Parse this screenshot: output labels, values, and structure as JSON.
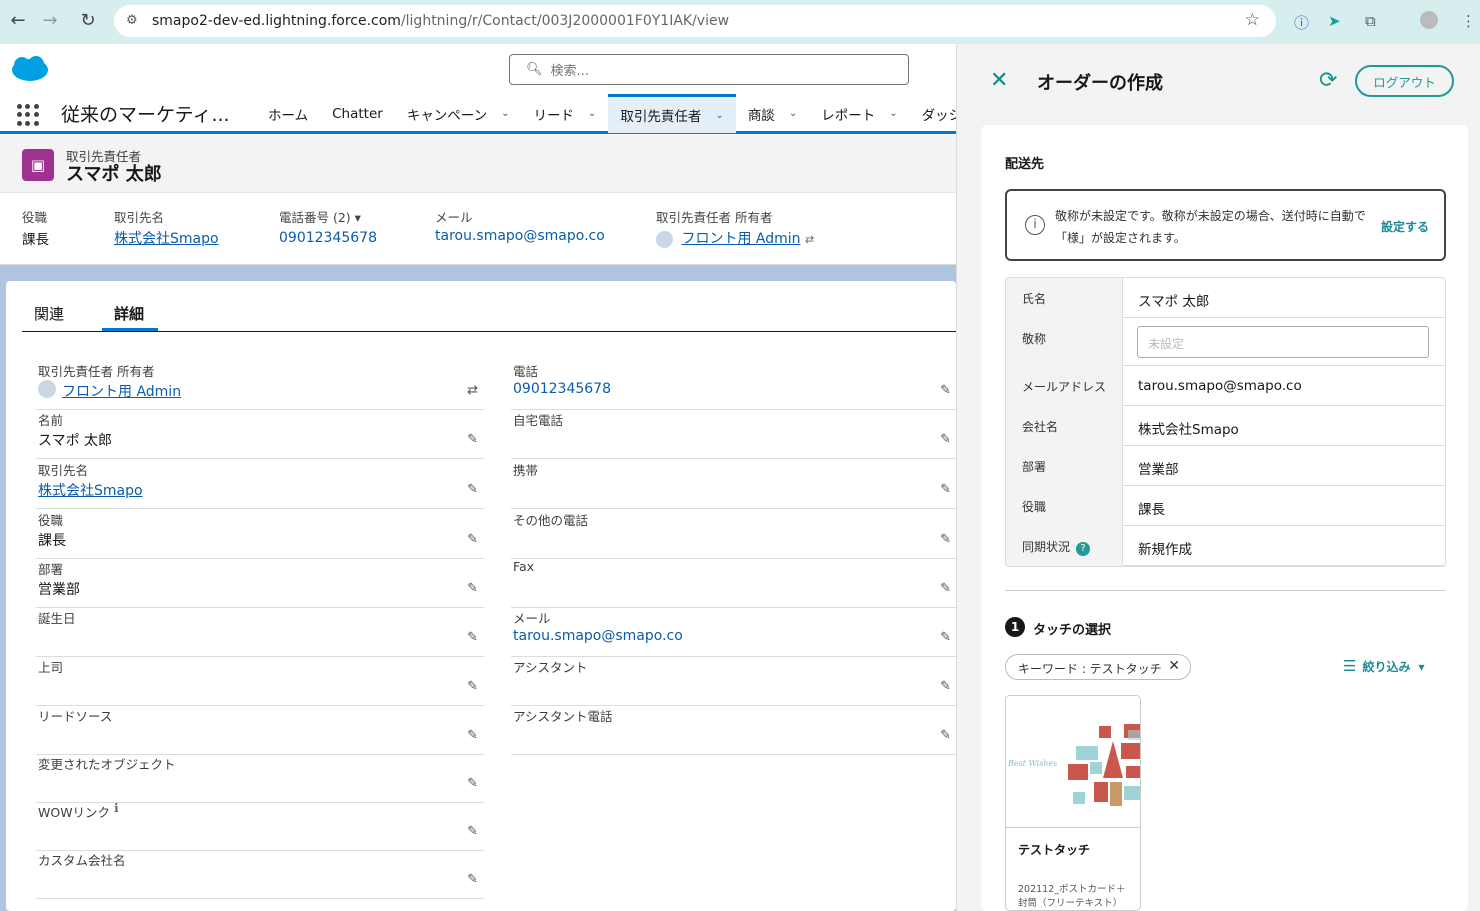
{
  "browser": {
    "url_host": "smapo2-dev-ed.lightning.force.com",
    "url_path": "/lightning/r/Contact/003J2000001F0Y1IAK/view"
  },
  "header": {
    "search_placeholder": "検索...",
    "app_name": "従来のマーケティ...",
    "tabs": [
      {
        "label": "ホーム",
        "chevron": false
      },
      {
        "label": "Chatter",
        "chevron": false
      },
      {
        "label": "キャンペーン",
        "chevron": true
      },
      {
        "label": "リード",
        "chevron": true
      },
      {
        "label": "取引先責任者",
        "chevron": true,
        "active": true
      },
      {
        "label": "商談",
        "chevron": true
      },
      {
        "label": "レポート",
        "chevron": true
      },
      {
        "label": "ダッシ",
        "chevron": false
      }
    ]
  },
  "record": {
    "object_label": "取引先責任者",
    "name": "スマポ 太郎",
    "highlights": {
      "title_label": "役職",
      "title_value": "課長",
      "account_label": "取引先名",
      "account_value": "株式会社Smapo",
      "phone_label": "電話番号 (2)",
      "phone_value": "09012345678",
      "email_label": "メール",
      "email_value": "tarou.smapo@smapo.co",
      "owner_label": "取引先責任者 所有者",
      "owner_value": "フロント用 Admin"
    }
  },
  "detail": {
    "tabs": [
      "関連",
      "詳細"
    ],
    "left": [
      {
        "label": "取引先責任者 所有者",
        "value": "フロント用 Admin",
        "link": true
      },
      {
        "label": "名前",
        "value": "スマポ 太郎"
      },
      {
        "label": "取引先名",
        "value": "株式会社Smapo",
        "link": true
      },
      {
        "label": "役職",
        "value": "課長"
      },
      {
        "label": "部署",
        "value": "営業部"
      },
      {
        "label": "誕生日",
        "value": ""
      },
      {
        "label": "上司",
        "value": ""
      },
      {
        "label": "リードソース",
        "value": ""
      },
      {
        "label": "変更されたオブジェクト",
        "value": ""
      },
      {
        "label": "WOWリンク",
        "value": ""
      },
      {
        "label": "カスタム会社名",
        "value": ""
      }
    ],
    "right": [
      {
        "label": "電話",
        "value": "09012345678"
      },
      {
        "label": "自宅電話",
        "value": ""
      },
      {
        "label": "携帯",
        "value": ""
      },
      {
        "label": "その他の電話",
        "value": ""
      },
      {
        "label": "Fax",
        "value": ""
      },
      {
        "label": "メール",
        "value": "tarou.smapo@smapo.co"
      },
      {
        "label": "アシスタント",
        "value": ""
      },
      {
        "label": "アシスタント電話",
        "value": ""
      }
    ]
  },
  "panel": {
    "title": "オーダーの作成",
    "logout_label": "ログアウト",
    "section_title": "配送先",
    "notice_text": "敬称が未設定です。敬称が未設定の場合、送付時に自動で「様」が設定されます。",
    "notice_action": "設定する",
    "fields": [
      {
        "label": "氏名",
        "value": "スマポ 太郎"
      },
      {
        "label": "敬称",
        "placeholder": "未設定"
      },
      {
        "label": "メールアドレス",
        "value": "tarou.smapo@smapo.co"
      },
      {
        "label": "会社名",
        "value": "株式会社Smapo"
      },
      {
        "label": "部署",
        "value": "営業部"
      },
      {
        "label": "役職",
        "value": "課長"
      },
      {
        "label": "同期状況",
        "value": "新規作成",
        "help": "?"
      }
    ],
    "step_number": "1",
    "step_title": "タッチの選択",
    "filter_pill": "キーワード : テストタッチ",
    "filter_label": "絞り込み",
    "touch_card": {
      "name": "テストタッチ",
      "desc": "202112_ポストカード＋封筒（フリーテキスト）",
      "image_text": "Best Wishes"
    }
  }
}
